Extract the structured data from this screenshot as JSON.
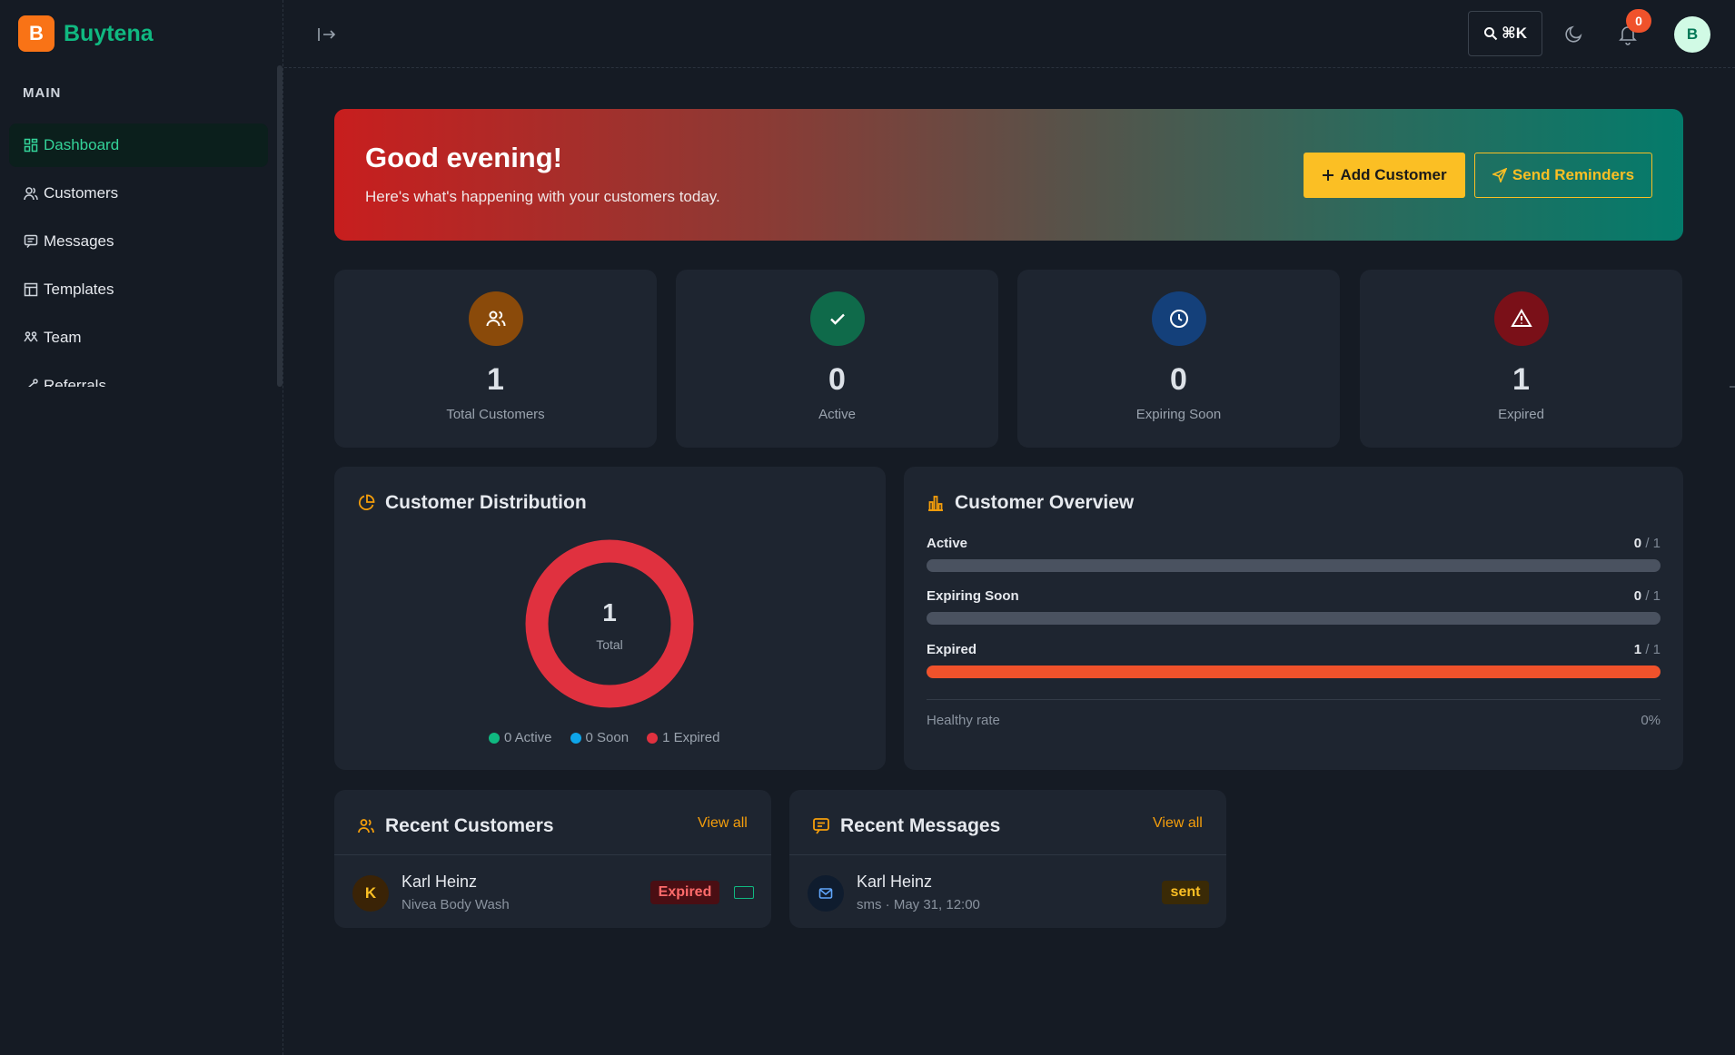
{
  "brand": {
    "initial": "B",
    "name": "Buytena"
  },
  "sidebar": {
    "section": "MAIN",
    "items": [
      {
        "label": "Dashboard",
        "icon": "dashboard-icon",
        "active": true
      },
      {
        "label": "Customers",
        "icon": "users-icon"
      },
      {
        "label": "Messages",
        "icon": "message-icon"
      },
      {
        "label": "Templates",
        "icon": "template-icon"
      },
      {
        "label": "Team",
        "icon": "team-icon"
      },
      {
        "label": "Referrals",
        "icon": "share-icon"
      }
    ]
  },
  "header": {
    "shortcut": "⌘K",
    "notification_count": "0",
    "avatar_initial": "B"
  },
  "hero": {
    "title": "Good evening!",
    "subtitle": "Here's what's happening with your customers today.",
    "add_label": "Add Customer",
    "send_label": "Send Reminders"
  },
  "stats": [
    {
      "value": "1",
      "label": "Total Customers",
      "color": "#8a4a0a",
      "icon": "users-icon"
    },
    {
      "value": "0",
      "label": "Active",
      "color": "#0f6a4a",
      "icon": "check-icon"
    },
    {
      "value": "0",
      "label": "Expiring Soon",
      "color": "#14407a",
      "icon": "clock-icon"
    },
    {
      "value": "1",
      "label": "Expired",
      "color": "#7a1018",
      "icon": "alert-icon"
    }
  ],
  "distribution": {
    "title": "Customer Distribution",
    "total_value": "1",
    "total_label": "Total",
    "segments": {
      "active": 0,
      "soon": 0,
      "expired": 1
    },
    "legend": {
      "active": "0 Active",
      "soon": "0 Soon",
      "expired": "1 Expired"
    },
    "colors": {
      "active": "#10b981",
      "soon": "#0ea5e9",
      "expired": "#e0313f"
    }
  },
  "overview": {
    "title": "Customer Overview",
    "rows": [
      {
        "label": "Active",
        "count": "0",
        "total": "/ 1",
        "fraction": 0
      },
      {
        "label": "Expiring Soon",
        "count": "0",
        "total": "/ 1",
        "fraction": 0
      },
      {
        "label": "Expired",
        "count": "1",
        "total": "/ 1",
        "fraction": 1
      }
    ],
    "healthy_label": "Healthy rate",
    "healthy_value": "0%"
  },
  "recent_customers": {
    "title": "Recent Customers",
    "view_all": "View all",
    "row": {
      "initial": "K",
      "name": "Karl Heinz",
      "product": "Nivea Body Wash",
      "status": "Expired"
    }
  },
  "recent_messages": {
    "title": "Recent Messages",
    "view_all": "View all",
    "row": {
      "name": "Karl Heinz",
      "meta": "sms · May 31, 12:00",
      "status": "sent"
    }
  }
}
